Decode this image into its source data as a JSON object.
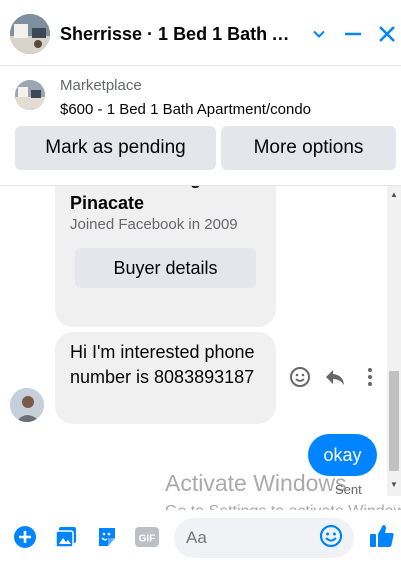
{
  "header": {
    "title": "Sherrisse · 1 Bed 1 Bath Ap...",
    "icons": [
      "chevron-down-icon",
      "minimize-icon",
      "close-icon"
    ]
  },
  "listing": {
    "source": "Marketplace",
    "item": "$600 - 1 Bed 1 Bath Apartment/condo",
    "buttons": {
      "pending": "Mark as pending",
      "more": "More options"
    }
  },
  "profile_card": {
    "name": "Sherrisse Baliguat-Pinacate",
    "joined": "Joined Facebook in 2009",
    "buyer_button": "Buyer details"
  },
  "messages": {
    "received": "Hi I'm interested phone number is 8083893187",
    "sent": "okay",
    "sent_status": "Sent"
  },
  "composer": {
    "placeholder": "Aa",
    "icons": [
      "add-icon",
      "photo-icon",
      "sticker-icon",
      "gif-icon",
      "emoji-icon",
      "like-icon"
    ]
  },
  "watermark": {
    "title": "Activate Windows",
    "subtitle": "Go to Settings to activate Windows."
  },
  "colors": {
    "accent": "#0084ff",
    "bubble_received": "#f0f0f0",
    "button_gray": "#e4e6eb",
    "muted_text": "#65676b"
  }
}
